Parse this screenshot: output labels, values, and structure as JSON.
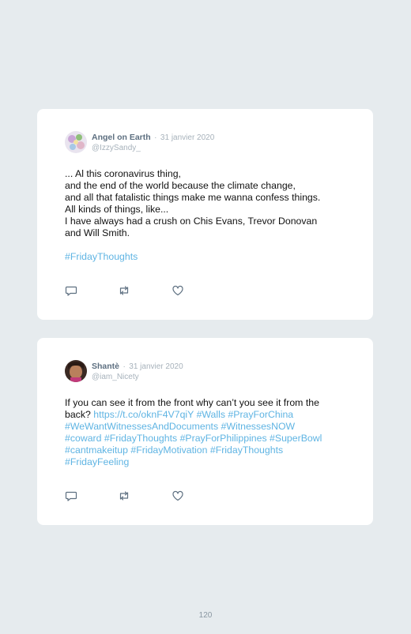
{
  "tweets": [
    {
      "name": "Angel on Earth",
      "separator": "·",
      "date": "31 janvier 2020",
      "handle": "@IzzySandy_",
      "lines": [
        "... Al this coronavirus thing,",
        "and the end of the world because the climate change,",
        "and all that fatalistic things make me wanna confess things.",
        "All kinds of things, like...",
        "I have always had a crush on Chis Evans, Trevor Donovan",
        "and Will Smith."
      ],
      "hashtag": "#FridayThoughts",
      "avatar_icon": "avatar-floral",
      "action_icons": [
        "reply-icon",
        "retweet-icon",
        "like-icon"
      ]
    },
    {
      "name": "Shantè",
      "separator": "·",
      "date": "31 janvier 2020",
      "handle": "@iam_Nicety",
      "line1": "If you can see it from the front why can’t you see it from the",
      "line2_plain": "back? ",
      "line2_link": "https://t.co/oknF4V7qiY #Walls #PrayForChina",
      "line3": "#WeWantWitnessesAndDocuments #WitnessesNOW",
      "line4": "#coward #FridayThoughts #PrayForPhilippines #SuperBowl",
      "line5": "#cantmakeitup #FridayMotivation #FridayThoughts",
      "line6": "#FridayFeeling",
      "avatar_icon": "avatar-portrait",
      "action_icons": [
        "reply-icon",
        "retweet-icon",
        "like-icon"
      ]
    }
  ],
  "page_number": "120",
  "colors": {
    "background": "#e6ebee",
    "card": "#ffffff",
    "hashtag": "#5fb4e3",
    "name": "#5d6f80",
    "meta": "#a7b2bb"
  }
}
